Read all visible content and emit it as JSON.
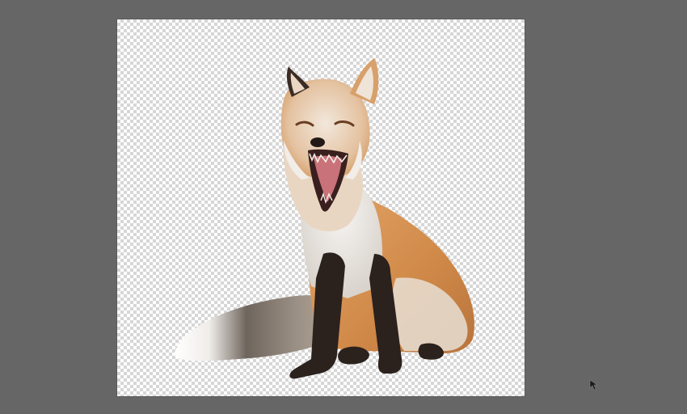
{
  "workspace": {
    "background_color": "#666666",
    "canvas_background": "transparency-checkerboard"
  },
  "layer": {
    "subject": "red-fox-cutout",
    "colors": {
      "fur_orange": "#d9955a",
      "fur_cream": "#efe6dc",
      "chest_white": "#f3f1ef",
      "legs_dark": "#2b211d",
      "mouth_pink": "#c9727a",
      "tail_gray": "#8a8078"
    }
  },
  "cursor": {
    "icon": "arrow-pointer-icon"
  }
}
